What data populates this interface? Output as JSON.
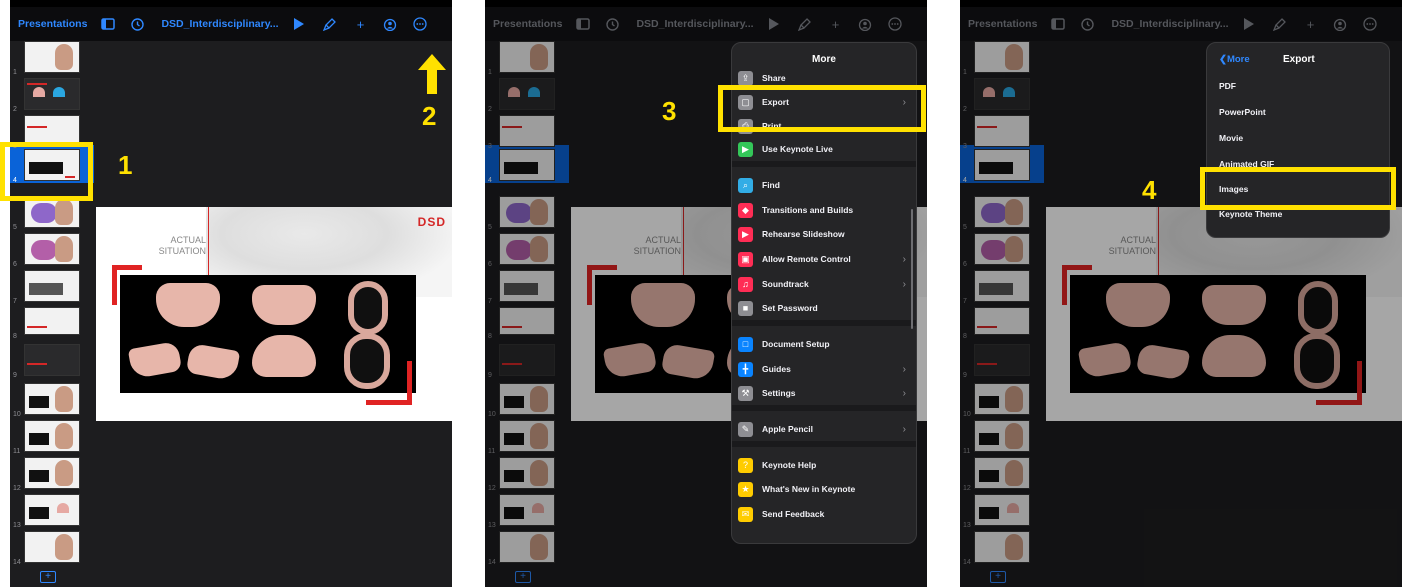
{
  "toolbar": {
    "presentations_label": "Presentations",
    "document_title": "DSD_Interdisciplinary..."
  },
  "slides": [
    {
      "number": "1"
    },
    {
      "number": "2"
    },
    {
      "number": "3"
    },
    {
      "number": "4"
    },
    {
      "number": "5"
    },
    {
      "number": "6"
    },
    {
      "number": "7"
    },
    {
      "number": "8"
    },
    {
      "number": "9"
    },
    {
      "number": "10"
    },
    {
      "number": "11"
    },
    {
      "number": "12"
    },
    {
      "number": "13"
    },
    {
      "number": "14"
    }
  ],
  "selected_slide": 4,
  "slide_canvas": {
    "heading_line1": "ACTUAL",
    "heading_line2": "SITUATION",
    "logo_text": "DSD"
  },
  "more_menu": {
    "title": "More",
    "items": [
      {
        "label": "Share",
        "icon": "share-icon",
        "color": "#8e8e93"
      },
      {
        "label": "Export",
        "icon": "export-icon",
        "color": "#8e8e93",
        "chevron": true
      },
      {
        "label": "Print",
        "icon": "print-icon",
        "color": "#8e8e93"
      },
      {
        "label": "Use Keynote Live",
        "icon": "keynote-live-icon",
        "color": "#34c759"
      },
      {
        "label": "Find",
        "icon": "find-icon",
        "color": "#32ade6"
      },
      {
        "label": "Transitions and Builds",
        "icon": "transitions-icon",
        "color": "#ff2d55"
      },
      {
        "label": "Rehearse Slideshow",
        "icon": "rehearse-icon",
        "color": "#ff2d55"
      },
      {
        "label": "Allow Remote Control",
        "icon": "remote-icon",
        "color": "#ff2d55",
        "chevron": true
      },
      {
        "label": "Soundtrack",
        "icon": "soundtrack-icon",
        "color": "#ff2d55",
        "chevron": true
      },
      {
        "label": "Set Password",
        "icon": "password-icon",
        "color": "#8e8e93"
      },
      {
        "label": "Document Setup",
        "icon": "document-setup-icon",
        "color": "#0a84ff"
      },
      {
        "label": "Guides",
        "icon": "guides-icon",
        "color": "#0a84ff",
        "chevron": true
      },
      {
        "label": "Settings",
        "icon": "settings-icon",
        "color": "#8e8e93",
        "chevron": true
      },
      {
        "label": "Apple Pencil",
        "icon": "apple-pencil-icon",
        "color": "#8e8e93",
        "chevron": true
      },
      {
        "label": "Keynote Help",
        "icon": "help-icon",
        "color": "#ffcc00"
      },
      {
        "label": "What's New in Keynote",
        "icon": "whats-new-icon",
        "color": "#ffcc00"
      },
      {
        "label": "Send Feedback",
        "icon": "feedback-icon",
        "color": "#ffcc00"
      }
    ]
  },
  "export_menu": {
    "back_label": "More",
    "title": "Export",
    "items": [
      {
        "label": "PDF"
      },
      {
        "label": "PowerPoint"
      },
      {
        "label": "Movie"
      },
      {
        "label": "Animated GIF"
      },
      {
        "label": "Images"
      },
      {
        "label": "Keynote Theme"
      }
    ]
  },
  "annotations": {
    "step1": "1",
    "step2": "2",
    "step3": "3",
    "step4": "4",
    "highlight_color": "#ffe100"
  },
  "colors": {
    "accent": "#2f88ff",
    "selection": "#0a63d8",
    "brand_red": "#e02323"
  }
}
